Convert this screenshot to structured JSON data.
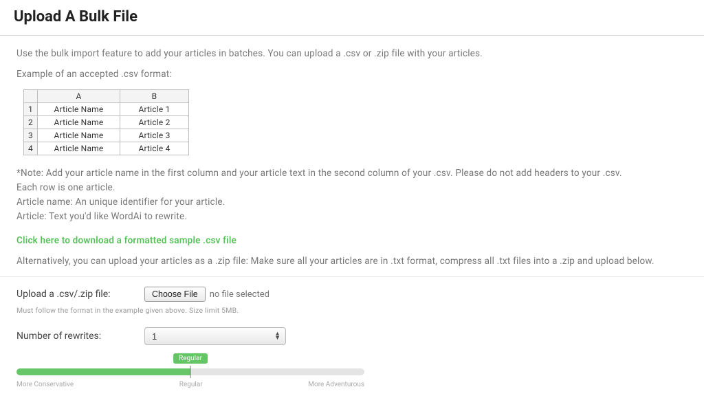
{
  "page": {
    "title": "Upload A Bulk File"
  },
  "intro": {
    "desc": "Use the bulk import feature to add your articles in batches. You can upload a .csv or .zip file with your articles.",
    "example_label": "Example of an accepted .csv format:"
  },
  "csv_table": {
    "col_a": "A",
    "col_b": "B",
    "rows": [
      {
        "n": "1",
        "name": "Article Name",
        "val": "Article 1"
      },
      {
        "n": "2",
        "name": "Article Name",
        "val": "Article 2"
      },
      {
        "n": "3",
        "name": "Article Name",
        "val": "Article 3"
      },
      {
        "n": "4",
        "name": "Article Name",
        "val": "Article 4"
      }
    ]
  },
  "notes": {
    "note1": "*Note: Add your article name in the first column and your article text in the second column of your .csv. Please do not add headers to your .csv.",
    "note2": "Each row is one article.",
    "note3": "Article name: An unique identifier for your article.",
    "note4": "Article: Text you'd like WordAi to rewrite."
  },
  "download_link": "Click here to download a formatted sample .csv file",
  "alt_text": "Alternatively, you can upload your articles as a .zip file: Make sure all your articles are in .txt format, compress all .txt files into a .zip and upload below.",
  "form": {
    "upload_label": "Upload a .csv/.zip file:",
    "choose_file_btn": "Choose File",
    "no_file_text": "no file selected",
    "hint": "Must follow the format in the example given above. Size limit 5MB.",
    "rewrites_label": "Number of rewrites:",
    "rewrites_value": "1"
  },
  "slider": {
    "badge": "Regular",
    "left": "More Conservative",
    "mid": "Regular",
    "right": "More Adventurous"
  }
}
